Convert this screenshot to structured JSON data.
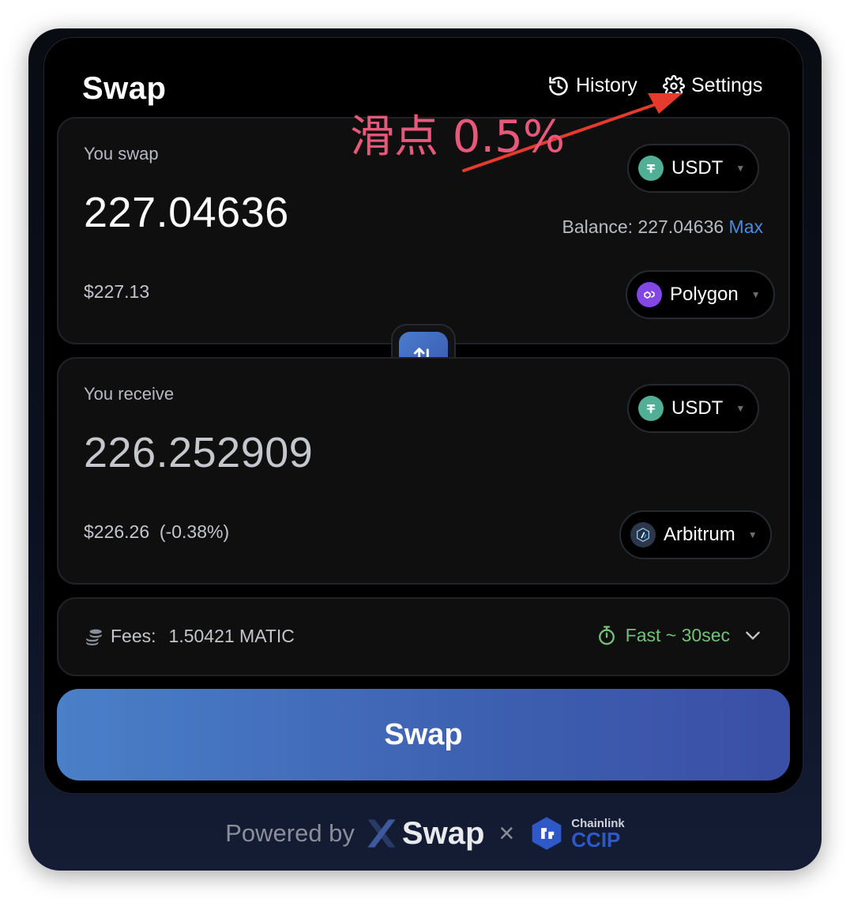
{
  "header": {
    "title": "Swap",
    "history_label": "History",
    "settings_label": "Settings"
  },
  "annotation": {
    "text": "滑点 0.5%",
    "color": "#e8587a"
  },
  "from": {
    "label": "You swap",
    "amount": "227.04636",
    "token": "USDT",
    "balance_label": "Balance: 227.04636",
    "max_label": "Max",
    "usd_value": "$227.13",
    "network": "Polygon"
  },
  "to": {
    "label": "You receive",
    "amount": "226.252909",
    "token": "USDT",
    "usd_value": "$226.26",
    "price_impact": "(-0.38%)",
    "network": "Arbitrum"
  },
  "fees": {
    "label": "Fees:",
    "value": "1.50421 MATIC",
    "speed": "Fast ~ 30sec"
  },
  "swap_button_label": "Swap",
  "footer": {
    "powered_by": "Powered by",
    "brand": "Swap",
    "times": "×",
    "partner_small": "Chainlink",
    "partner_big": "CCIP"
  },
  "colors": {
    "accent_blue": "#4a80c8",
    "max_blue": "#4a8be0",
    "fast_green": "#72c27a",
    "usdt_green": "#50af95",
    "polygon_purple": "#8247e5",
    "chainlink_blue": "#2f58c8"
  },
  "icons": {
    "history": "history-icon",
    "settings": "gear-icon",
    "switch": "swap-arrows-icon",
    "fees": "coins-icon",
    "speed": "stopwatch-icon",
    "expand": "chevron-down-icon"
  }
}
